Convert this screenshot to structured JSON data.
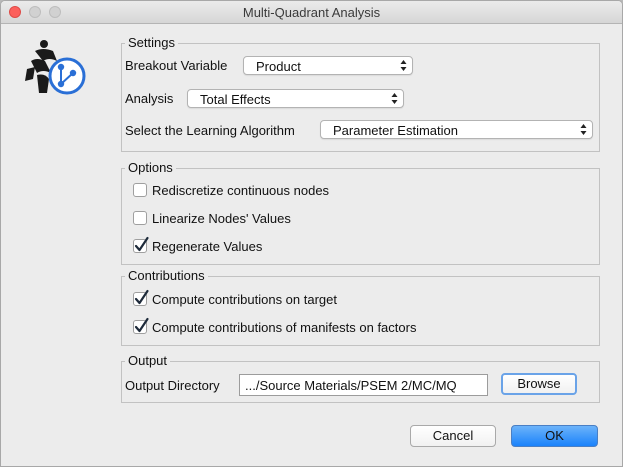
{
  "window": {
    "title": "Multi-Quadrant Analysis"
  },
  "settings": {
    "legend": "Settings",
    "breakout_label": "Breakout Variable",
    "breakout_value": "Product",
    "analysis_label": "Analysis",
    "analysis_value": "Total Effects",
    "algorithm_label": "Select the Learning Algorithm",
    "algorithm_value": "Parameter Estimation"
  },
  "options": {
    "legend": "Options",
    "items": [
      {
        "label": "Rediscretize continuous nodes",
        "checked": false
      },
      {
        "label": "Linearize Nodes' Values",
        "checked": false
      },
      {
        "label": "Regenerate Values",
        "checked": true
      }
    ]
  },
  "contributions": {
    "legend": "Contributions",
    "items": [
      {
        "label": "Compute contributions on target",
        "checked": true
      },
      {
        "label": "Compute contributions of manifests on factors",
        "checked": true
      }
    ]
  },
  "output": {
    "legend": "Output",
    "dir_label": "Output Directory",
    "dir_value": ".../Source Materials/PSEM 2/MC/MQ",
    "browse_label": "Browse"
  },
  "buttons": {
    "cancel": "Cancel",
    "ok": "OK"
  },
  "colors": {
    "accent": "#1a82fb",
    "check": "#1d2a3a",
    "logo": "#2a6fd6"
  }
}
